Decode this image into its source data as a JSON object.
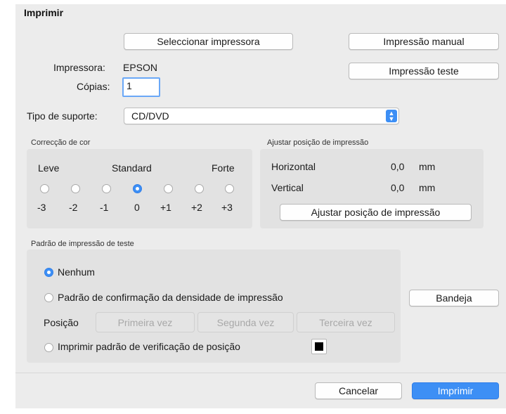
{
  "title": "Imprimir",
  "buttons": {
    "select_printer": "Seleccionar impressora",
    "manual_print": "Impressão manual",
    "test_print": "Impressão teste",
    "adjust_position": "Ajustar posição de impressão",
    "tray": "Bandeja",
    "cancel": "Cancelar",
    "print": "Imprimir"
  },
  "printer": {
    "label": "Impressora:",
    "value": "EPSON"
  },
  "copies": {
    "label": "Cópias:",
    "value": "1"
  },
  "media_type": {
    "label": "Tipo de suporte:",
    "value": "CD/DVD"
  },
  "color_correction": {
    "title": "Correcção de cor",
    "low": "Leve",
    "standard": "Standard",
    "strong": "Forte",
    "levels": [
      "-3",
      "-2",
      "-1",
      "0",
      "+1",
      "+2",
      "+3"
    ],
    "selected": "0"
  },
  "print_position": {
    "title": "Ajustar posição de impressão",
    "horizontal_label": "Horizontal",
    "horizontal_value": "0,0",
    "vertical_label": "Vertical",
    "vertical_value": "0,0",
    "unit": "mm"
  },
  "test_pattern": {
    "title": "Padrão de impressão de teste",
    "none": "Nenhum",
    "density": "Padrão de confirmação da densidade de impressão",
    "position_label": "Posição",
    "first": "Primeira vez",
    "second": "Segunda vez",
    "third": "Terceira vez",
    "check_position": "Imprimir padrão de verificação de posição",
    "selected": "Nenhum"
  },
  "colors": {
    "accent": "#3d8ff5",
    "panel": "#ececec",
    "group": "#e2e2e2"
  }
}
